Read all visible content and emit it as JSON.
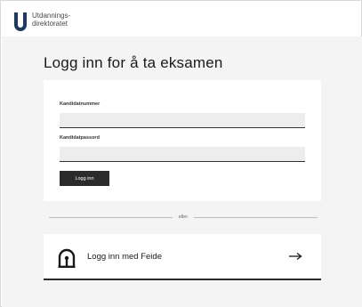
{
  "header": {
    "logo_line1": "Utdannings-",
    "logo_line2": "direktoratet",
    "logo_icon": "udir-logo-icon",
    "brand_color": "#1f3a5f"
  },
  "page": {
    "title": "Logg inn for å ta eksamen"
  },
  "login_form": {
    "candidate_number_label": "Kandidatnummer",
    "candidate_number_value": "",
    "candidate_password_label": "Kandidatpassord",
    "candidate_password_value": "",
    "submit_label": "Logg inn"
  },
  "divider": {
    "text": "eller"
  },
  "feide": {
    "label": "Logg inn med Feide",
    "icon": "feide-icon",
    "arrow_icon": "arrow-right-icon"
  }
}
